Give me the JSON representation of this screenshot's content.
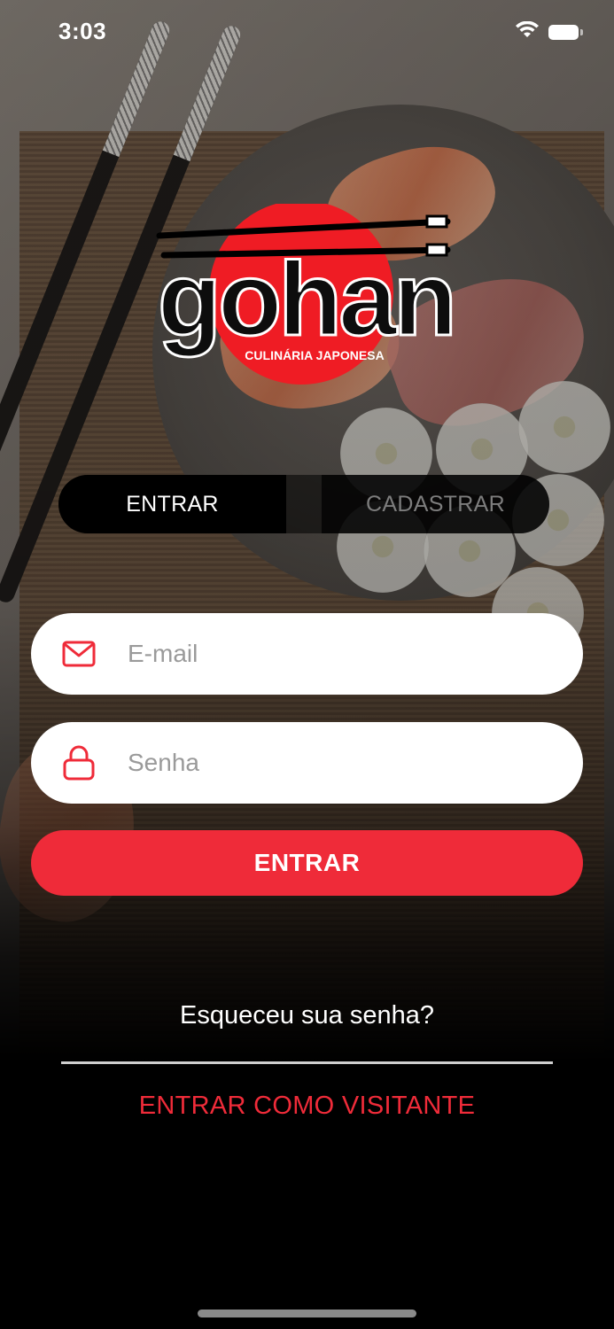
{
  "status_bar": {
    "time": "3:03",
    "icons": [
      "wifi-icon",
      "battery-icon"
    ]
  },
  "logo": {
    "brand": "gohan",
    "tagline": "CULINÁRIA JAPONESA",
    "accent_color": "#ef1c24"
  },
  "tabs": [
    {
      "label": "ENTRAR",
      "active": true
    },
    {
      "label": "CADASTRAR",
      "active": false
    }
  ],
  "form": {
    "email": {
      "value": "",
      "placeholder": "E-mail",
      "icon": "mail-icon"
    },
    "password": {
      "value": "",
      "placeholder": "Senha",
      "icon": "lock-icon"
    },
    "submit_label": "ENTRAR"
  },
  "links": {
    "forgot_password": "Esqueceu sua senha?",
    "guest": "ENTRAR COMO VISITANTE"
  },
  "colors": {
    "accent": "#ef2b39",
    "background": "#000000",
    "field_background": "#ffffff"
  }
}
